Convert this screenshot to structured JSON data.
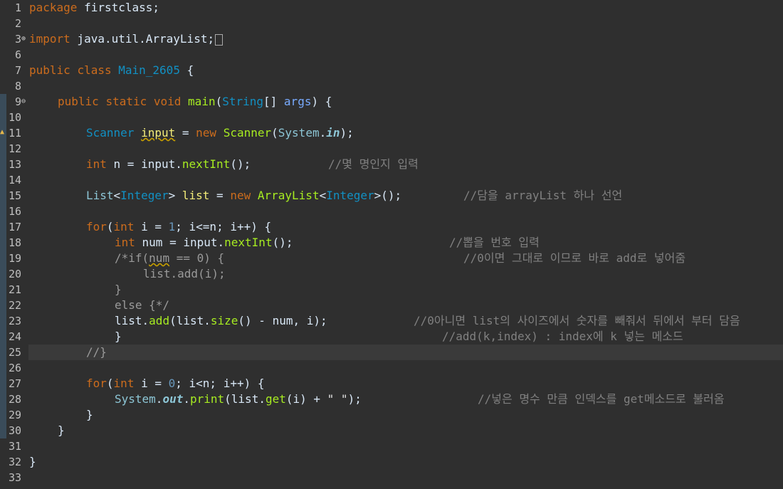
{
  "editor": {
    "line_numbers": [
      "1",
      "2",
      "3",
      "6",
      "7",
      "8",
      "9",
      "10",
      "11",
      "12",
      "13",
      "14",
      "15",
      "16",
      "17",
      "18",
      "19",
      "20",
      "21",
      "22",
      "23",
      "24",
      "25",
      "26",
      "27",
      "28",
      "29",
      "30",
      "31",
      "32",
      "33"
    ],
    "code": {
      "l1": {
        "kw": "package",
        "rest": " firstclass;"
      },
      "l3": {
        "kw": "import",
        "rest": " java.util.ArrayList;"
      },
      "l7": {
        "kw1": "public",
        "kw2": "class",
        "cls": "Main_2605",
        "rest": " {"
      },
      "l9": {
        "kw1": "public",
        "kw2": "static",
        "kw3": "void",
        "fn": "main",
        "p1": "(",
        "ty": "String",
        "p2": "[] ",
        "par": "args",
        "rest": ") {"
      },
      "l11": {
        "ty1": "Scanner",
        "var": "input",
        "eq": " = ",
        "kw": "new",
        "sp": " ",
        "fn": "Scanner",
        "p1": "(",
        "ty2": "System",
        "dot": ".",
        "it": "in",
        "rest": ");"
      },
      "l13": {
        "kw": "int",
        "rest1": " n = input.",
        "fn": "nextInt",
        "rest2": "();",
        "cm": "//몇 명인지 입력"
      },
      "l15": {
        "ty1": "List",
        "lt": "<",
        "ty2": "Integer",
        "gt": ">",
        "var": " list",
        "eq": " = ",
        "kw": "new",
        "sp": " ",
        "fn": "ArrayList",
        "lt2": "<",
        "ty3": "Integer",
        "rest": ">();",
        "cm": "//담을 arrayList 하나 선언"
      },
      "l17": {
        "kw1": "for",
        "p1": "(",
        "kw2": "int",
        "rest1": " i = ",
        "n": "1",
        "rest2": "; i<=n; i++) {"
      },
      "l18": {
        "kw": "int",
        "rest1": " num = input.",
        "fn": "nextInt",
        "rest2": "();",
        "cm": "//뽑을 번호 입력"
      },
      "l19": {
        "cm_a": "/*if(",
        "cm_sq": "num",
        "cm_b": " == 0) {",
        "cm": "//0이면 그대로 이므로 바로 add로 넣어줌"
      },
      "l20": {
        "cm": "list.add(i);"
      },
      "l21": {
        "cm": "}"
      },
      "l22": {
        "cm": "else {*/"
      },
      "l23": {
        "rest1": "list.",
        "fn1": "add",
        "rest2": "(list.",
        "fn2": "size",
        "rest3": "() - num, i);",
        "cm": "//0아니면 list의 사이즈에서 숫자를 빼줘서 뒤에서 부터 담음"
      },
      "l24": {
        "rest": "}",
        "cm": "//add(k,index) : index에 k 넣는 메소드"
      },
      "l25": {
        "cm": "//}"
      },
      "l27": {
        "kw1": "for",
        "p1": "(",
        "kw2": "int",
        "rest1": " i = ",
        "n": "0",
        "rest2": "; i<n; i++) {"
      },
      "l28": {
        "ty": "System",
        "dot": ".",
        "it": "out",
        "dot2": ".",
        "fn1": "print",
        "rest1": "(list.",
        "fn2": "get",
        "rest2": "(i) + ",
        "str": "\" \"",
        "rest3": ");",
        "cm": "//넣은 명수 만큼 인덱스를 get메소드로 불러옴"
      },
      "l29": {
        "rest": "}"
      },
      "l30": {
        "rest": "}"
      },
      "l32": {
        "rest": "}"
      }
    }
  }
}
